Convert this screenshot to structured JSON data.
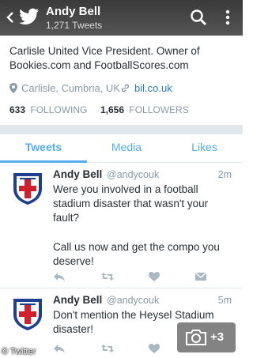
{
  "header": {
    "name": "Andy Bell",
    "tweet_count": "1,271 Tweets"
  },
  "profile": {
    "bio": "Carlisle United Vice President. Owner of Bookies.com and FootballScores.com",
    "location": "Carlisle, Cumbria, UK",
    "website": "bil.co.uk",
    "following_count": "633",
    "following_label": "FOLLOWING",
    "followers_count": "1,656",
    "followers_label": "FOLLOWERS"
  },
  "tabs": [
    {
      "label": "Tweets",
      "active": true
    },
    {
      "label": "Media",
      "active": false
    },
    {
      "label": "Likes",
      "active": false
    }
  ],
  "tweets": [
    {
      "name": "Andy Bell",
      "handle": "@andycouk",
      "time": "2m",
      "text": "Were you involved in a football stadium disaster that wasn't your fault?",
      "text2": "Call us now and get the compo you deserve!"
    },
    {
      "name": "Andy Bell",
      "handle": "@andycouk",
      "time": "5m",
      "text": "Don't mention the Heysel Stadium disaster!"
    }
  ],
  "overlay": {
    "caption": "© Twitter",
    "photo_count": "+3"
  },
  "colors": {
    "accent": "#55acee",
    "link": "#2b7bb9",
    "muted": "#8899a6"
  }
}
